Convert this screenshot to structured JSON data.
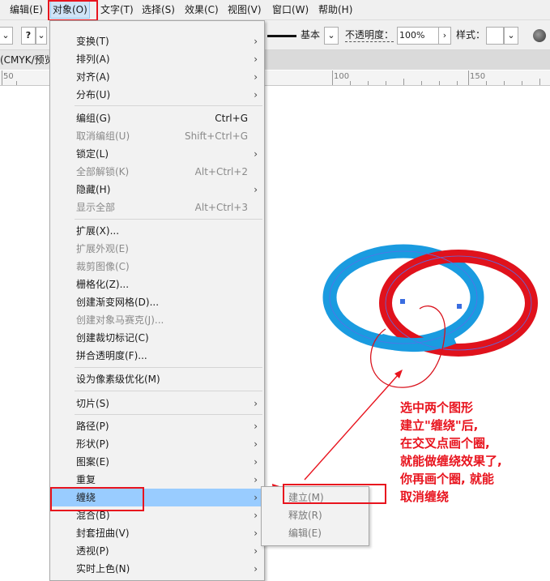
{
  "menubar": {
    "items": [
      "编辑(E)",
      "对象(O)",
      "文字(T)",
      "选择(S)",
      "效果(C)",
      "视图(V)",
      "窗口(W)",
      "帮助(H)"
    ]
  },
  "control_bar": {
    "help_glyph": "?",
    "stroke_style": "基本",
    "opacity_label": "不透明度：",
    "opacity_value": "100%",
    "style_label": "样式："
  },
  "document": {
    "tab_title": "(CMYK/预览",
    "ruler_numbers": [
      "50",
      "100",
      "150"
    ]
  },
  "object_menu": {
    "items": [
      {
        "label": "变换(T)",
        "submenu": true
      },
      {
        "label": "排列(A)",
        "submenu": true
      },
      {
        "label": "对齐(A)",
        "submenu": true
      },
      {
        "label": "分布(U)",
        "submenu": true
      },
      {
        "label": "编组(G)",
        "shortcut": "Ctrl+G"
      },
      {
        "label": "取消编组(U)",
        "shortcut": "Shift+Ctrl+G",
        "disabled": true
      },
      {
        "label": "锁定(L)",
        "submenu": true
      },
      {
        "label": "全部解锁(K)",
        "shortcut": "Alt+Ctrl+2",
        "disabled": true
      },
      {
        "label": "隐藏(H)",
        "submenu": true
      },
      {
        "label": "显示全部",
        "shortcut": "Alt+Ctrl+3",
        "disabled": true
      },
      {
        "label": "扩展(X)..."
      },
      {
        "label": "扩展外观(E)",
        "disabled": true
      },
      {
        "label": "裁剪图像(C)",
        "disabled": true
      },
      {
        "label": "栅格化(Z)..."
      },
      {
        "label": "创建渐变网格(D)..."
      },
      {
        "label": "创建对象马赛克(J)...",
        "disabled": true
      },
      {
        "label": "创建裁切标记(C)"
      },
      {
        "label": "拼合透明度(F)..."
      },
      {
        "label": "设为像素级优化(M)"
      },
      {
        "label": "切片(S)",
        "submenu": true
      },
      {
        "label": "路径(P)",
        "submenu": true
      },
      {
        "label": "形状(P)",
        "submenu": true
      },
      {
        "label": "图案(E)",
        "submenu": true
      },
      {
        "label": "重复",
        "submenu": true
      },
      {
        "label": "缠绕",
        "submenu": true,
        "highlighted": true
      },
      {
        "label": "混合(B)",
        "submenu": true
      },
      {
        "label": "封套扭曲(V)",
        "submenu": true
      },
      {
        "label": "透视(P)",
        "submenu": true
      },
      {
        "label": "实时上色(N)",
        "submenu": true
      }
    ]
  },
  "submenu": {
    "items": [
      {
        "label": "建立(M)"
      },
      {
        "label": "释放(R)",
        "disabled": true
      },
      {
        "label": "编辑(E)",
        "disabled": true
      }
    ]
  },
  "annotation": {
    "lines": [
      "选中两个图形",
      "建立\"缠绕\"后,",
      "在交叉点画个圈,",
      "就能做缠绕效果了,",
      "你再画个圈, 就能",
      "取消缠绕"
    ]
  },
  "colors": {
    "annotation_red": "#e8141e",
    "blue_ring": "#1a9be0",
    "red_ring": "#e0121c",
    "menu_highlight": "#99ccff"
  }
}
